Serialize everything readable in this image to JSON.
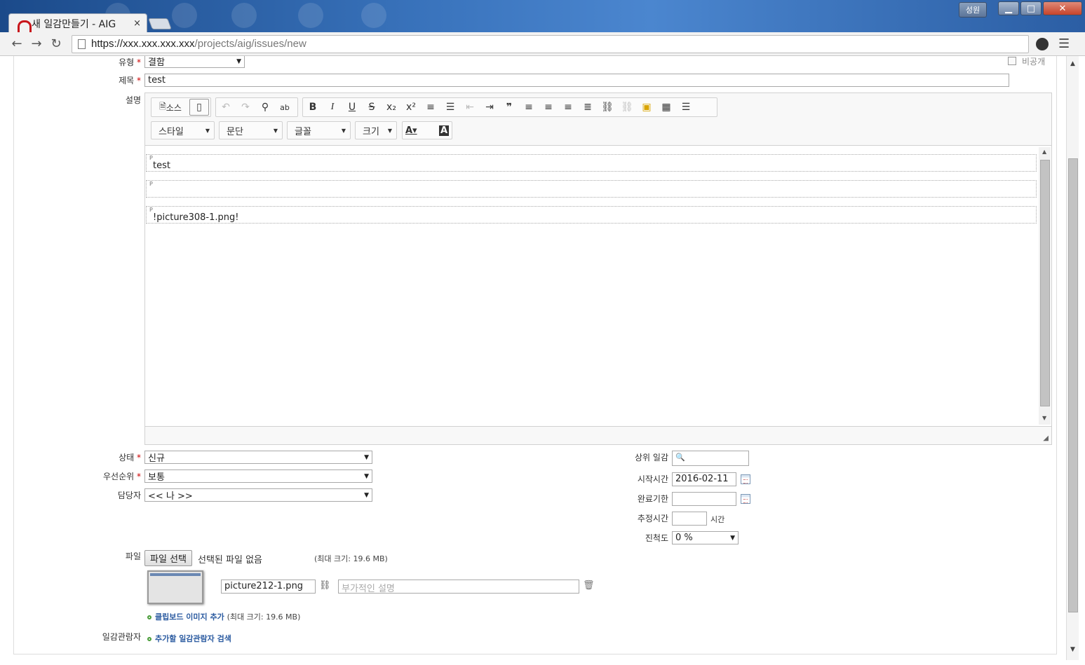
{
  "browser": {
    "tab_title": "새 일감만들기 - AIG",
    "tab_close": "×",
    "profile_name": "성원",
    "url_host": "https://xxx.xxx.xxx.xxx",
    "url_path": "/projects/aig/issues/new"
  },
  "form": {
    "type_label": "유형",
    "type_value": "결함",
    "private_label": "비공개",
    "subject_label": "제목",
    "subject_value": "test",
    "description_label": "설명",
    "required_mark": "*",
    "editor": {
      "source_label": "소스",
      "style_label": "스타일",
      "format_label": "문단",
      "font_label": "글꼴",
      "size_label": "크기",
      "paragraph_tag": "P",
      "paragraphs": [
        "test",
        "",
        "!picture308-1.png!"
      ]
    },
    "status_label": "상태",
    "status_value": "신규",
    "priority_label": "우선순위",
    "priority_value": "보통",
    "assignee_label": "담당자",
    "assignee_value": "<< 나 >>",
    "parent_label": "상위 일감",
    "start_label": "시작시간",
    "start_value": "2016-02-11",
    "due_label": "완료기한",
    "estimate_label": "추정시간",
    "estimate_unit": "시간",
    "done_label": "진척도",
    "done_value": "0 %",
    "file_label": "파일",
    "file_button": "파일 선택",
    "file_none": "선택된 파일 없음",
    "max_size": "(최대 크기: 19.6 MB)",
    "attachment_name": "picture212-1.png",
    "attachment_desc_placeholder": "부가적인 설명",
    "clipboard_link": "클립보드 이미지 추가",
    "watchers_label": "일감관람자",
    "watchers_link": "추가할 일감관람자 검색"
  }
}
